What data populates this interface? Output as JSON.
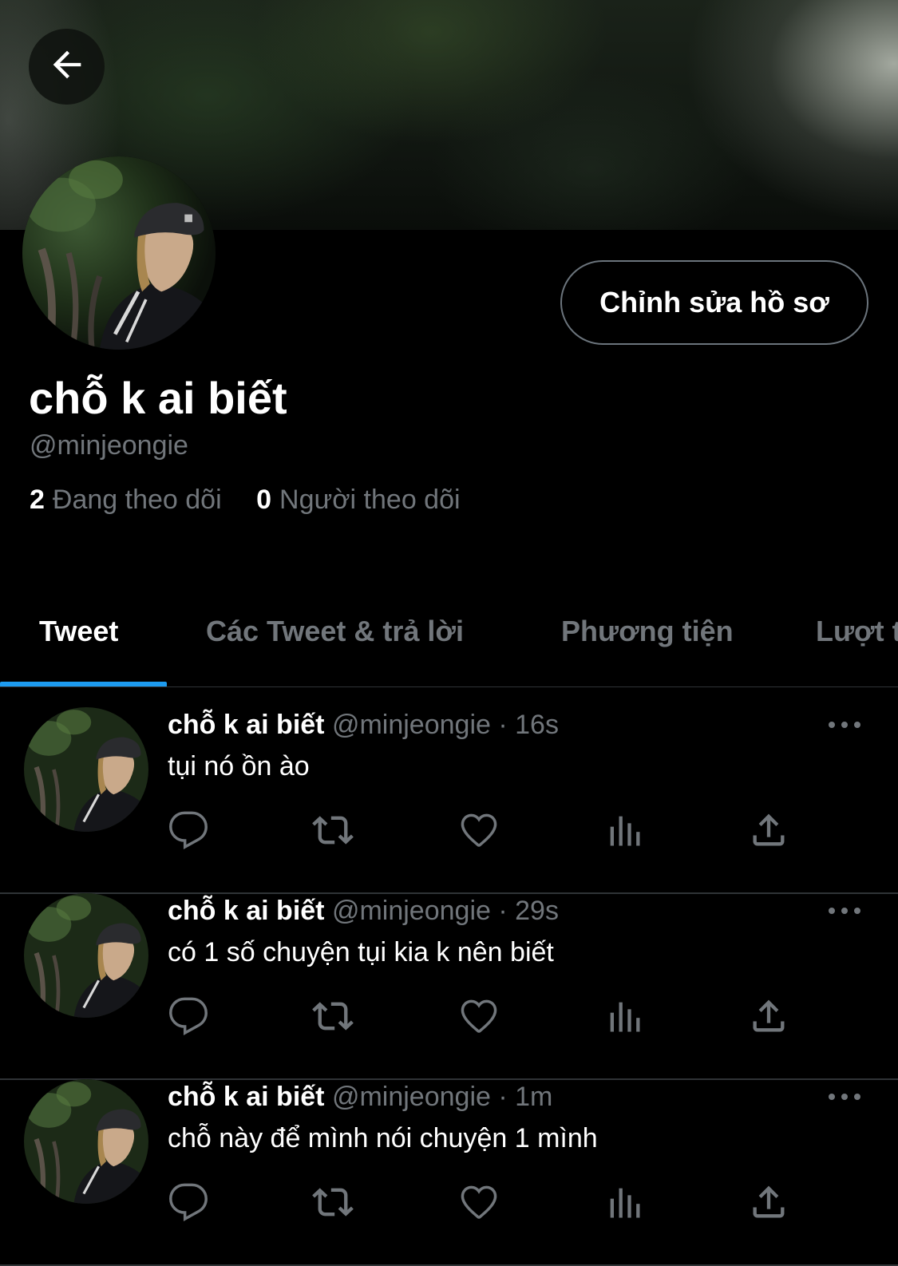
{
  "header": {
    "back_icon": "arrow-left-icon",
    "banner": "night-trees-banner-photo"
  },
  "profile": {
    "display_name": "chỗ k ai biết",
    "handle": "@minjeongie",
    "edit_button_label": "Chỉnh sửa hồ sơ",
    "following_count": "2",
    "following_label": "Đang theo dõi",
    "followers_count": "0",
    "followers_label": "Người theo dõi"
  },
  "tabs": [
    {
      "label": "Tweet",
      "active": true
    },
    {
      "label": "Các Tweet & trả lời",
      "active": false
    },
    {
      "label": "Phương tiện",
      "active": false
    },
    {
      "label": "Lượt t",
      "active": false
    }
  ],
  "tweets": [
    {
      "name": "chỗ k ai biết",
      "handle": "@minjeongie",
      "sep": "·",
      "time": "16s",
      "text": "tụi nó ồn ào"
    },
    {
      "name": "chỗ k ai biết",
      "handle": "@minjeongie",
      "sep": "·",
      "time": "29s",
      "text": "có 1 số chuyện tụi kia k nên biết"
    },
    {
      "name": "chỗ k ai biết",
      "handle": "@minjeongie",
      "sep": "·",
      "time": "1m",
      "text": "chỗ này để mình nói chuyện 1 mình"
    }
  ],
  "action_icons": [
    "reply-icon",
    "retweet-icon",
    "like-icon",
    "views-icon",
    "share-icon"
  ],
  "colors": {
    "accent": "#1d9bf0",
    "muted": "#71767b",
    "divider": "#2f3336",
    "background": "#000000"
  }
}
